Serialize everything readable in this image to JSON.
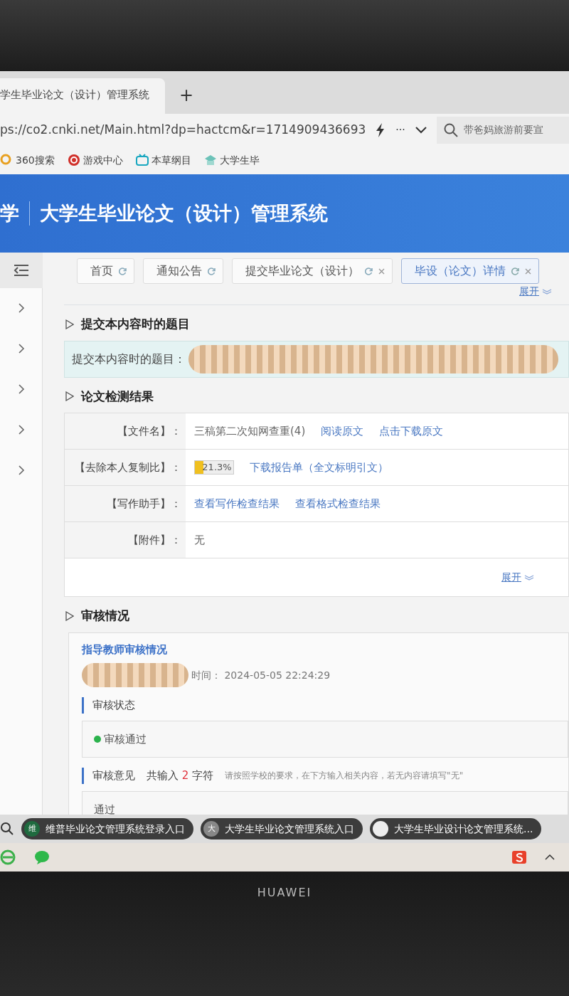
{
  "browser": {
    "tab_title": "学生毕业论文（设计）管理系统",
    "new_tab": "+",
    "url": "ps://co2.cnki.net/Main.html?dp=hactcm&r=1714909436693",
    "more": "···",
    "search_hint": "带爸妈旅游前要宣",
    "bookmarks": [
      {
        "kind": "search",
        "label": "360搜索"
      },
      {
        "kind": "game",
        "label": "游戏中心"
      },
      {
        "kind": "tv",
        "label": "本草纲目"
      },
      {
        "kind": "cap",
        "label": "大学生毕"
      }
    ]
  },
  "header": {
    "school": "学",
    "title": "大学生毕业论文（设计）管理系统"
  },
  "sidebar": {
    "items": [
      {
        "expanded": false
      },
      {
        "expanded": false
      },
      {
        "expanded": false
      },
      {
        "expanded": false
      },
      {
        "expanded": false
      }
    ]
  },
  "tabs": [
    {
      "label": "首页",
      "selected": false,
      "closable": false
    },
    {
      "label": "通知公告",
      "selected": false,
      "closable": false
    },
    {
      "label": "提交毕业论文（设计）",
      "selected": false,
      "closable": true
    },
    {
      "label": "毕设（论文）详情",
      "selected": true,
      "closable": true
    }
  ],
  "top_expand": "展开",
  "topic": {
    "heading": "提交本内容时的题目",
    "label": "提交本内容时的题目："
  },
  "check": {
    "heading": "论文检测结果",
    "rows": [
      {
        "kind": "links",
        "label": "【文件名】：",
        "text": "三稿第二次知网查重(4)",
        "links": [
          "阅读原文",
          "点击下载原文"
        ]
      },
      {
        "kind": "meter",
        "label": "【去除本人复制比】：",
        "reading": "21.3%",
        "level": 0.213,
        "links": [
          "下载报告单（全文标明引文）"
        ]
      },
      {
        "kind": "links",
        "label": "【写作助手】：",
        "links": [
          "查看写作检查结果",
          "查看格式检查结果"
        ]
      },
      {
        "kind": "links",
        "label": "【附件】：",
        "text": "无",
        "links": []
      }
    ],
    "expand": "展开"
  },
  "review": {
    "heading": "审核情况",
    "panel_title": "指导教师审核情况",
    "time_label": "时间：",
    "time": "2024-05-05 22:24:29",
    "status_label": "审核状态",
    "status": {
      "text": "审核通过",
      "color": "#2bb24c"
    },
    "opinion_label": "审核意见",
    "count_prefix": "共输入",
    "count": "2",
    "count_suffix": "字符",
    "hint": "请按照学校的要求，在下方输入相关内容，若无内容请填写\"无\"",
    "opinion": "通过"
  },
  "suggestions": [
    {
      "badge": "维",
      "text": "维普毕业论文管理系统登录入口"
    },
    {
      "badge": "大",
      "text": "大学生毕业论文管理系统入口"
    },
    {
      "text": "大学生毕业设计论文管理系统..."
    }
  ],
  "bezel": {
    "brand": "HUAWEI"
  }
}
